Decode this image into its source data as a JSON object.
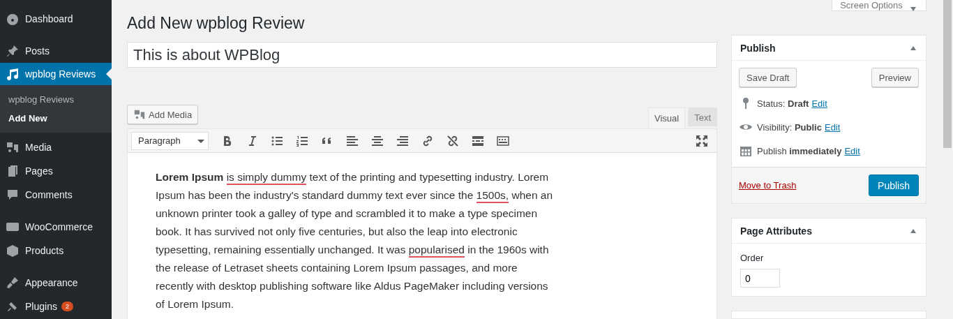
{
  "sidebar": {
    "groups": [
      [
        {
          "label": "Dashboard",
          "selected": false
        }
      ],
      [
        {
          "label": "Posts",
          "selected": false
        },
        {
          "label": "wpblog Reviews",
          "selected": true,
          "submenu": [
            {
              "label": "wpblog Reviews",
              "selected": false
            },
            {
              "label": "Add New",
              "selected": true
            }
          ]
        },
        {
          "label": "Media",
          "selected": false
        },
        {
          "label": "Pages",
          "selected": false
        },
        {
          "label": "Comments",
          "selected": false
        }
      ],
      [
        {
          "label": "WooCommerce",
          "selected": false
        },
        {
          "label": "Products",
          "selected": false
        }
      ],
      [
        {
          "label": "Appearance",
          "selected": false
        },
        {
          "label": "Plugins",
          "selected": false,
          "badge": "2"
        }
      ]
    ]
  },
  "screen_options": "Screen Options",
  "page_title": "Add New wpblog Review",
  "post_title": "This is about WPBlog",
  "editor": {
    "add_media": "Add Media",
    "tabs": [
      {
        "label": "Visual",
        "selected": true
      },
      {
        "label": "Text",
        "selected": false
      }
    ],
    "format": "Paragraph",
    "content": [
      {
        "text": "Lorem Ipsum ",
        "bold": true,
        "misspelled": false
      },
      {
        "text": "is simply dummy",
        "bold": false,
        "misspelled": true
      },
      {
        "text": " text of the printing and typesetting industry. Lorem Ipsum has been the industry's standard dummy text ever since the ",
        "bold": false,
        "misspelled": false
      },
      {
        "text": "1500s,",
        "bold": false,
        "misspelled": true
      },
      {
        "text": " when an unknown printer took a galley of type and scrambled it to make a type specimen book. It has survived not only five centuries, but also the leap into electronic typesetting, remaining essentially unchanged. It was ",
        "bold": false,
        "misspelled": false
      },
      {
        "text": "popularised",
        "bold": false,
        "misspelled": true
      },
      {
        "text": " in the 1960s with the release of Letraset sheets containing Lorem Ipsum passages, and more recently with desktop publishing software like Aldus PageMaker including versions of Lorem Ipsum.",
        "bold": false,
        "misspelled": false
      }
    ]
  },
  "publish": {
    "title": "Publish",
    "save_draft": "Save Draft",
    "preview": "Preview",
    "rows": [
      {
        "label": "Status:",
        "value": "Draft",
        "link": "Edit"
      },
      {
        "label": "Visibility:",
        "value": "Public",
        "link": "Edit"
      },
      {
        "label": "Publish",
        "value": "immediately",
        "link": "Edit"
      }
    ],
    "trash": "Move to Trash",
    "publish_button": "Publish"
  },
  "page_attributes": {
    "title": "Page Attributes",
    "order_label": "Order",
    "order_value": "0"
  }
}
